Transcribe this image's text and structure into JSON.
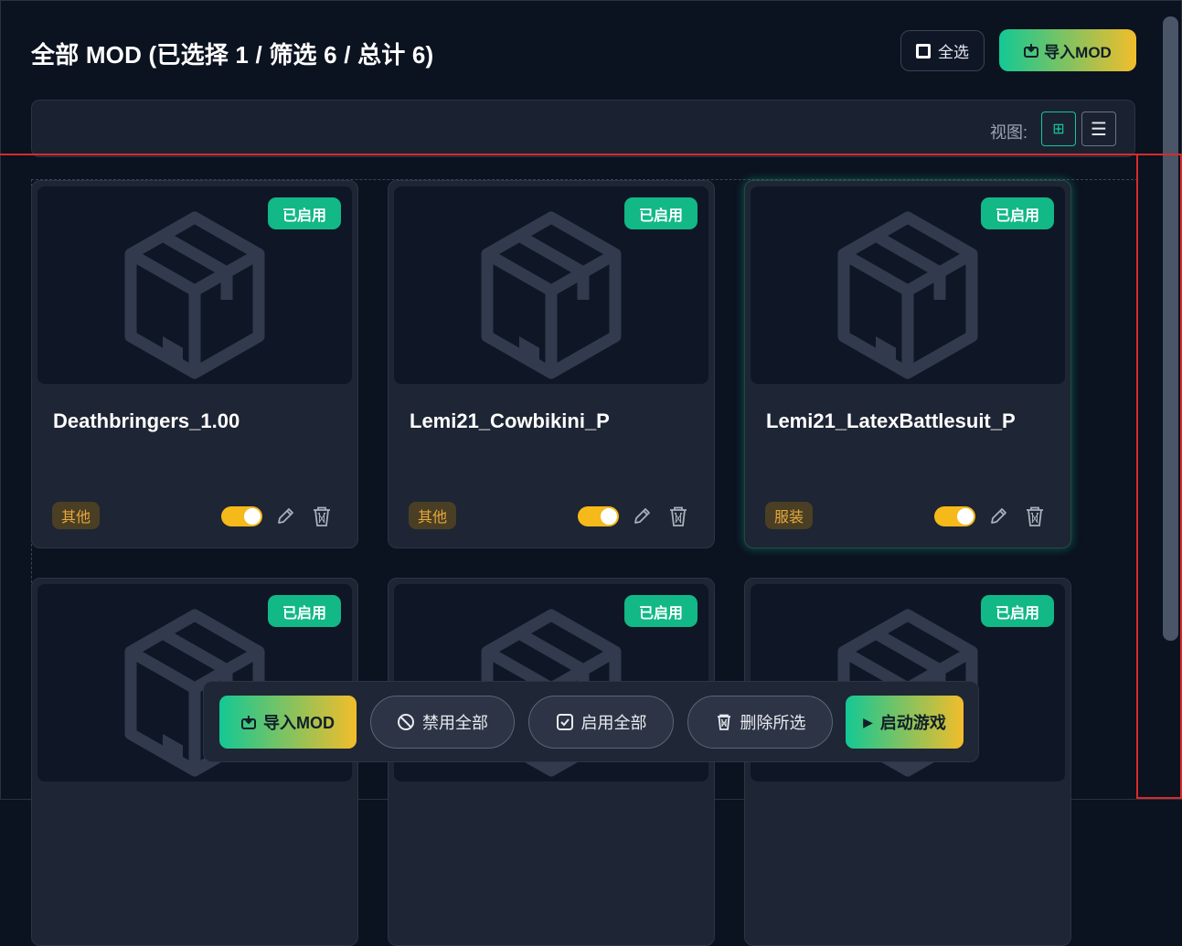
{
  "header": {
    "title": "全部 MOD (已选择 1 / 筛选 6 / 总计 6)",
    "select_all_label": "全选",
    "import_label": "导入MOD"
  },
  "view": {
    "label": "视图:",
    "grid_icon": "⊞",
    "list_icon": "☰"
  },
  "cards": [
    {
      "name": "Deathbringers_1.00",
      "status": "已启用",
      "category": "其他",
      "enabled": true
    },
    {
      "name": "Lemi21_Cowbikini_P",
      "status": "已启用",
      "category": "其他",
      "enabled": true
    },
    {
      "name": "Lemi21_LatexBattlesuit_P",
      "status": "已启用",
      "category": "服装",
      "enabled": true,
      "selected": true
    },
    {
      "name": "",
      "status": "已启用",
      "category": "",
      "enabled": true
    },
    {
      "name": "",
      "status": "已启用",
      "category": "",
      "enabled": true
    },
    {
      "name": "",
      "status": "已启用",
      "category": "",
      "enabled": true
    }
  ],
  "bottom_bar": {
    "import_label": "导入MOD",
    "disable_all_label": "禁用全部",
    "enable_all_label": "启用全部",
    "delete_selected_label": "删除所选",
    "launch_label": "启动游戏",
    "launch_icon": "▶"
  },
  "colors": {
    "accent_green": "#12b886",
    "accent_yellow": "#f5b91a",
    "background": "#0b1220"
  },
  "icons": [
    "checkbox-icon",
    "import-icon",
    "grid-view-icon",
    "list-view-icon",
    "package-icon",
    "edit-icon",
    "trash-icon",
    "ban-icon",
    "checkbox-checked-icon",
    "play-icon"
  ]
}
